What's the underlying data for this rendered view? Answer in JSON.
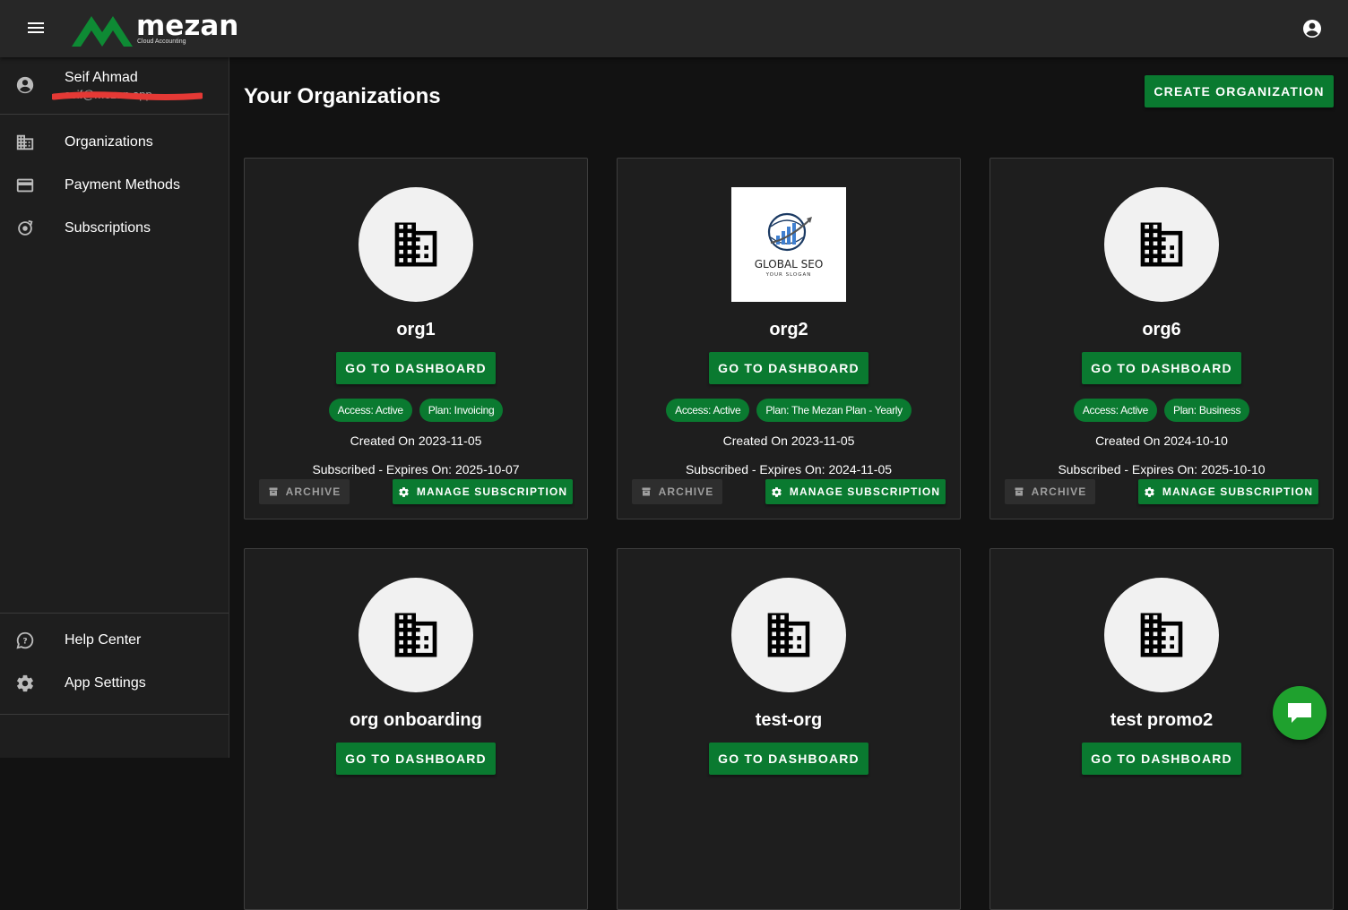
{
  "app": {
    "logo_name": "mezan",
    "logo_subtitle": "Cloud Accounting",
    "brand_color": "#0a7a30"
  },
  "sidebar": {
    "user_name": "Seif Ahmad",
    "user_email": "seif@mezan.app",
    "items": [
      {
        "label": "Organizations",
        "icon": "building-icon"
      },
      {
        "label": "Payment Methods",
        "icon": "credit-card-icon"
      },
      {
        "label": "Subscriptions",
        "icon": "subscription-icon"
      }
    ],
    "bottom_items": [
      {
        "label": "Help Center",
        "icon": "help-chat-icon"
      },
      {
        "label": "App Settings",
        "icon": "gear-icon"
      }
    ]
  },
  "main": {
    "title": "Your Organizations",
    "create_label": "CREATE ORGANIZATION",
    "dashboard_label": "GO TO DASHBOARD",
    "archive_label": "ARCHIVE",
    "manage_label": "MANAGE SUBSCRIPTION",
    "orgs": [
      {
        "name": "org1",
        "access": "Access: Active",
        "plan": "Plan: Invoicing",
        "created": "Created On 2023-11-05",
        "expires": "Subscribed - Expires On: 2025-10-07"
      },
      {
        "name": "org2",
        "access": "Access: Active",
        "plan": "Plan: The Mezan Plan - Yearly",
        "created": "Created On 2023-11-05",
        "expires": "Subscribed - Expires On: 2024-11-05",
        "logo_title": "GLOBAL SEO",
        "logo_slogan": "YOUR SLOGAN"
      },
      {
        "name": "org6",
        "access": "Access: Active",
        "plan": "Plan: Business",
        "created": "Created On 2024-10-10",
        "expires": "Subscribed - Expires On: 2025-10-10"
      },
      {
        "name": "org onboarding"
      },
      {
        "name": "test-org"
      },
      {
        "name": "test promo2"
      }
    ]
  }
}
